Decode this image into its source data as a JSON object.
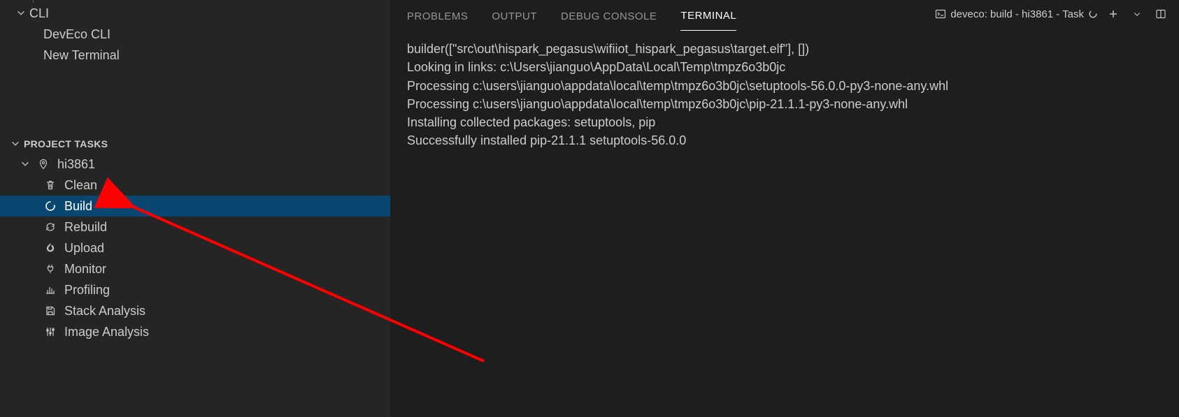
{
  "sidebar": {
    "cli_group": {
      "label": "CLI",
      "items": [
        {
          "label": "DevEco CLI"
        },
        {
          "label": "New Terminal"
        }
      ]
    },
    "project_tasks_header": "PROJECT TASKS",
    "project": {
      "name": "hi3861",
      "tasks": [
        {
          "id": "clean",
          "label": "Clean",
          "icon": "trash-icon",
          "selected": false
        },
        {
          "id": "build",
          "label": "Build",
          "icon": "spinner-icon",
          "selected": true
        },
        {
          "id": "rebuild",
          "label": "Rebuild",
          "icon": "refresh-icon",
          "selected": false
        },
        {
          "id": "upload",
          "label": "Upload",
          "icon": "flame-icon",
          "selected": false
        },
        {
          "id": "monitor",
          "label": "Monitor",
          "icon": "plug-icon",
          "selected": false
        },
        {
          "id": "profiling",
          "label": "Profiling",
          "icon": "barchart-icon",
          "selected": false
        },
        {
          "id": "stack-analysis",
          "label": "Stack Analysis",
          "icon": "save-icon",
          "selected": false
        },
        {
          "id": "image-analysis",
          "label": "Image Analysis",
          "icon": "sliders-icon",
          "selected": false
        }
      ]
    }
  },
  "panel": {
    "tabs": [
      {
        "id": "problems",
        "label": "PROBLEMS",
        "active": false
      },
      {
        "id": "output",
        "label": "OUTPUT",
        "active": false
      },
      {
        "id": "debug-console",
        "label": "DEBUG CONSOLE",
        "active": false
      },
      {
        "id": "terminal",
        "label": "TERMINAL",
        "active": true
      }
    ],
    "task_indicator": "deveco: build - hi3861 - Task",
    "output_lines": [
      "builder([\"src\\out\\hispark_pegasus\\wifiiot_hispark_pegasus\\target.elf\"], [])",
      "Looking in links: c:\\Users\\jianguo\\AppData\\Local\\Temp\\tmpz6o3b0jc",
      "Processing c:\\users\\jianguo\\appdata\\local\\temp\\tmpz6o3b0jc\\setuptools-56.0.0-py3-none-any.whl",
      "Processing c:\\users\\jianguo\\appdata\\local\\temp\\tmpz6o3b0jc\\pip-21.1.1-py3-none-any.whl",
      "Installing collected packages: setuptools, pip",
      "Successfully installed pip-21.1.1 setuptools-56.0.0"
    ]
  }
}
